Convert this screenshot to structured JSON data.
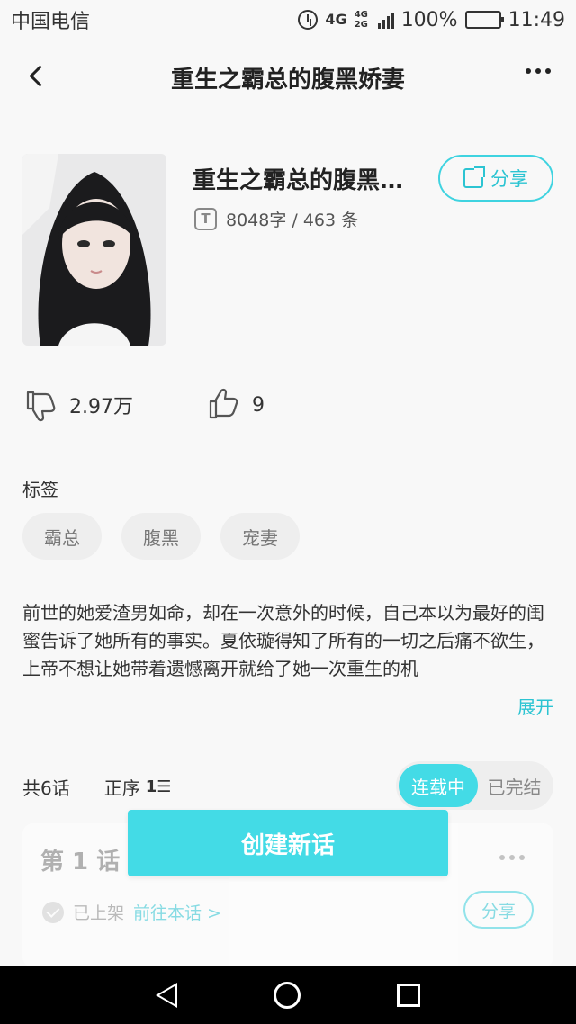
{
  "status_bar": {
    "carrier": "中国电信",
    "network": "4G",
    "network_secondary": "4G 2G",
    "battery": "100%",
    "time": "11:49",
    "icons": [
      "alarm-icon",
      "signal-icon",
      "battery-icon"
    ]
  },
  "navbar": {
    "title": "重生之霸总的腹黑娇妻",
    "back_icon": "chevron-left-icon",
    "more_icon": "more-dots-icon"
  },
  "book": {
    "title": "重生之霸总的腹黑娇妻",
    "meta": "8048字 / 463 条",
    "meta_icon_letter": "T",
    "share_label": "分享"
  },
  "stats": {
    "reads": "2.97万",
    "likes": "9"
  },
  "tags": {
    "label": "标签",
    "items": [
      "霸总",
      "腹黑",
      "宠妻"
    ]
  },
  "description": {
    "text": "前世的她爱渣男如命，却在一次意外的时候，自己本以为最好的闺蜜告诉了她所有的事实。夏依璇得知了所有的一切之后痛不欲生，上帝不想让她带着遗憾离开就给了她一次重生的机",
    "expand_label": "展开"
  },
  "chapters": {
    "count_label": "共6话",
    "order_label": "正序",
    "status_options": [
      "连载中",
      "已完结"
    ],
    "selected_status": "连载中",
    "first": {
      "title": "第 1 话",
      "status": "已上架",
      "link": "前往本话 >",
      "share": "分享"
    }
  },
  "create_button": "创建新话",
  "colors": {
    "accent": "#43dbe6",
    "accent_text": "#2cc4d2",
    "battery_green": "#3cc93c"
  }
}
